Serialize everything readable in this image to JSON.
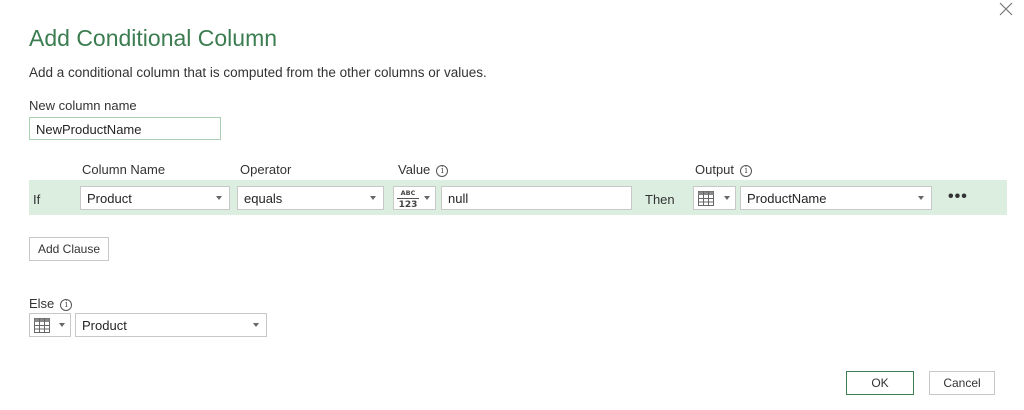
{
  "dialog": {
    "title": "Add Conditional Column",
    "description": "Add a conditional column that is computed from the other columns or values.",
    "close_icon": "close-icon"
  },
  "new_column": {
    "label": "New column name",
    "value": "NewProductName"
  },
  "headers": {
    "column_name": "Column Name",
    "operator": "Operator",
    "value": "Value",
    "output": "Output",
    "info_glyph": "i"
  },
  "clause": {
    "if_label": "If",
    "column": "Product",
    "operator": "equals",
    "value_type_icon": "abc-123-icon",
    "value_type_top": "ABC",
    "value_type_bottom": "123",
    "value": "null",
    "then_label": "Then",
    "output_type_icon": "table-column-icon",
    "output": "ProductName",
    "more_label": "•••"
  },
  "add_clause_label": "Add Clause",
  "else": {
    "label": "Else",
    "type_icon": "table-column-icon",
    "value": "Product"
  },
  "footer": {
    "ok_label": "OK",
    "cancel_label": "Cancel"
  },
  "colors": {
    "title": "#3b7d50",
    "row_highlight": "#dbeee0",
    "primary_border": "#3b7d50"
  }
}
